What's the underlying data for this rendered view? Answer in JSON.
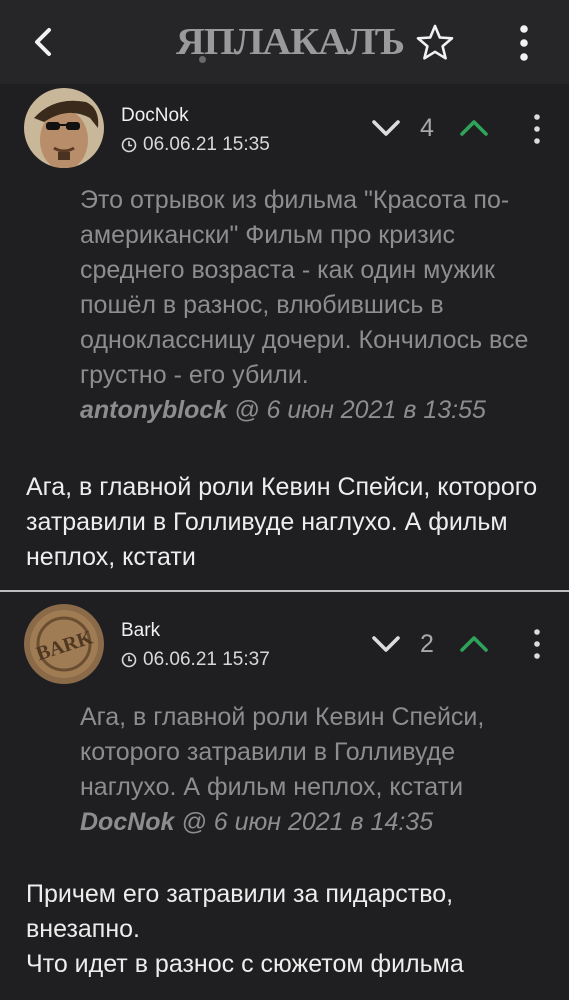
{
  "header": {
    "logo_text": "ЯПЛАКАЛЪ",
    "back_icon": "chevron-left-icon",
    "favorite_icon": "star-outline-icon",
    "menu_icon": "more-vertical-icon"
  },
  "colors": {
    "background": "#1f1f21",
    "topbar": "#262628",
    "quote_text": "#8d8d90",
    "upvote": "#2ea35a",
    "divider": "#bdbdbf"
  },
  "posts": [
    {
      "username": "DocNok",
      "timestamp": "06.06.21 15:35",
      "votes": "4",
      "quote_text": "Это отрывок из фильма \"Красота по-американски\" Фильм про кризис среднего возраста - как один мужик пошёл в разнос, влюбившись в одноклассницу дочери. Кончилось все грустно - его убили.",
      "quote_author": "antonyblock",
      "quote_meta": " @ 6 июн 2021 в 13:55",
      "reply_text": "Ага, в главной роли Кевин Спейси, которого затравили в Голливуде наглухо. А фильм неплох, кстати"
    },
    {
      "username": "Bark",
      "timestamp": "06.06.21 15:37",
      "votes": "2",
      "quote_text": "Ага, в главной роли Кевин Спейси, которого затравили в Голливуде наглухо. А фильм неплох, кстати",
      "quote_author": "DocNok",
      "quote_meta": " @ 6 июн 2021 в 14:35",
      "reply_line1": "Причем его затравили за пидарство, внезапно.",
      "reply_line2": "Что идет в разнос с сюжетом фильма"
    }
  ]
}
